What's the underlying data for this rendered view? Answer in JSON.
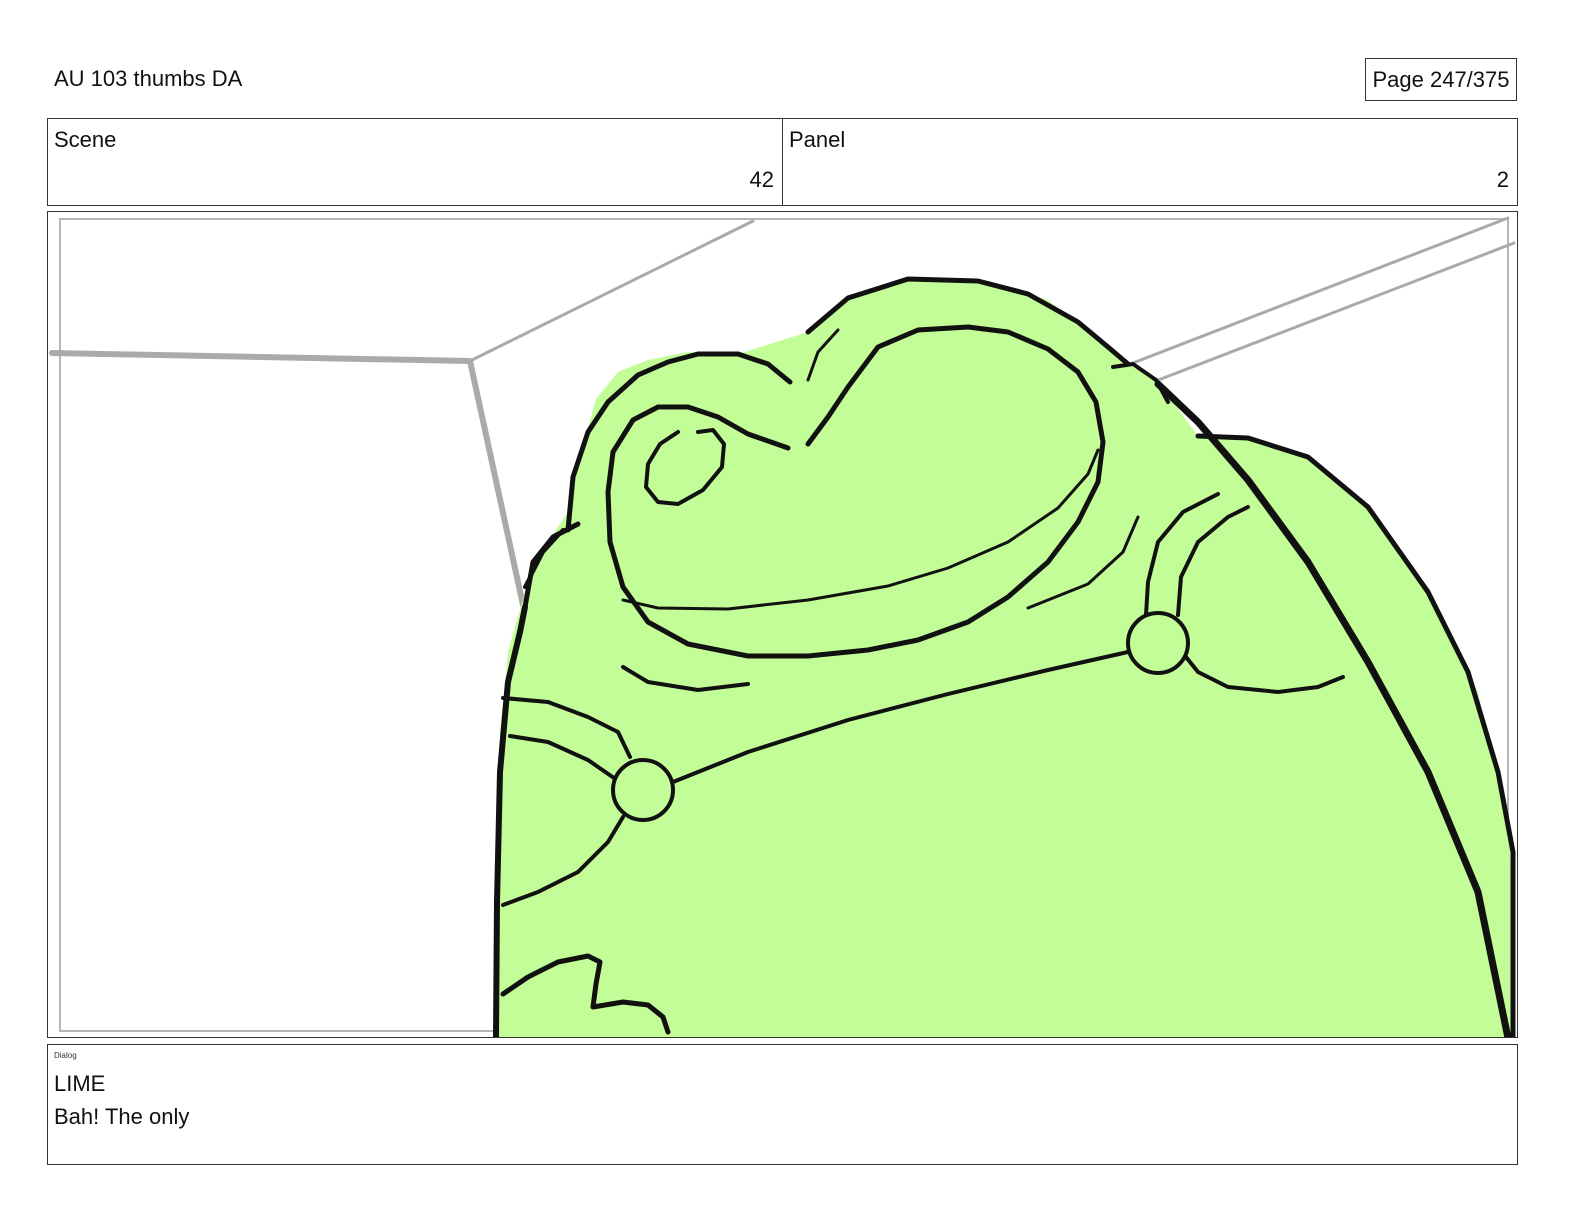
{
  "header": {
    "title": "AU 103 thumbs DA",
    "page_label": "Page 247/375"
  },
  "meta": {
    "scene_label": "Scene",
    "scene_value": "42",
    "panel_label": "Panel",
    "panel_value": "2"
  },
  "artwork": {
    "description_icon": "frog-character-drawing",
    "fill_color": "#c2fd97",
    "line_color": "#111111",
    "background_line_color": "#aaaaaa"
  },
  "dialog": {
    "tag": "Dialog",
    "speaker": "LIME",
    "line": "Bah!  The only"
  }
}
